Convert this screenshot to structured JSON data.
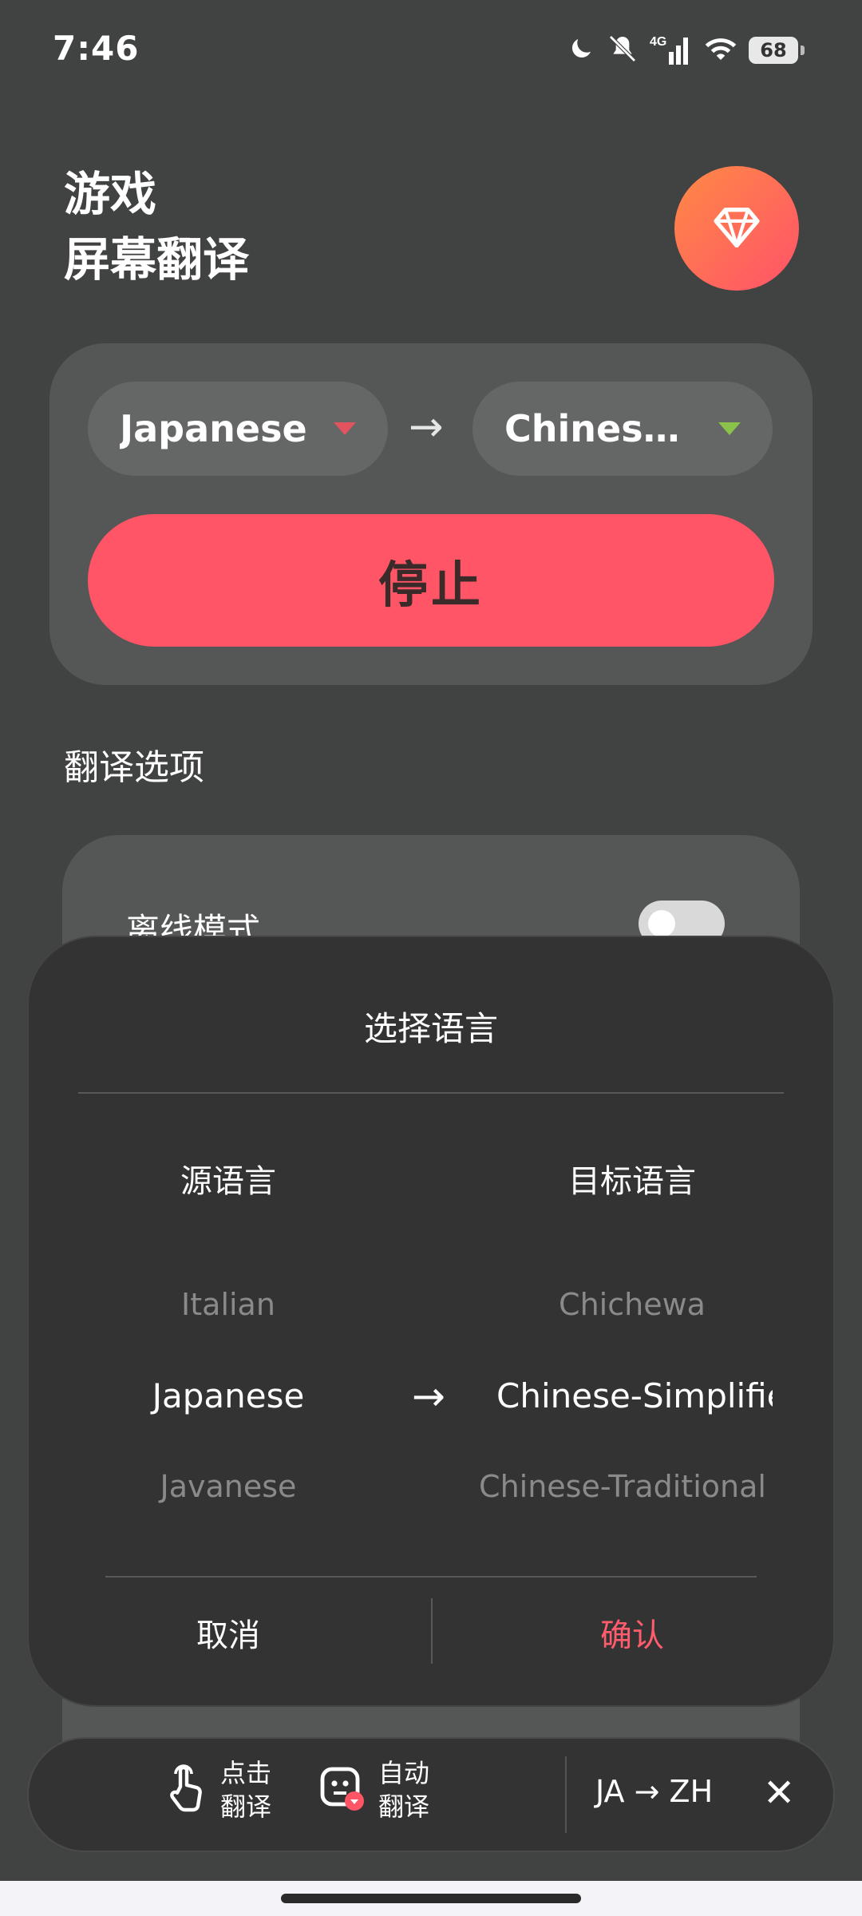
{
  "status": {
    "time": "7:46",
    "battery": "68",
    "network": "4G"
  },
  "header": {
    "line1": "游戏",
    "line2": "屏幕翻译"
  },
  "language_pair": {
    "source": "Japanese",
    "target": "Chinese...",
    "arrow": "→"
  },
  "stop_label": "停止",
  "options": {
    "title": "翻译选项",
    "offline_label": "离线模式"
  },
  "dialog": {
    "title": "选择语言",
    "source_header": "源语言",
    "target_header": "目标语言",
    "source_wheel": [
      "Italian",
      "Japanese",
      "Javanese"
    ],
    "target_wheel": [
      "Chichewa",
      "Chinese-Simplified",
      "Chinese-Traditional"
    ],
    "arrow": "→",
    "cancel": "取消",
    "confirm": "确认"
  },
  "float_bar": {
    "tap_line1": "点击",
    "tap_line2": "翻译",
    "auto_line1": "自动",
    "auto_line2": "翻译",
    "pair": "JA → ZH",
    "close": "✕"
  },
  "colors": {
    "accent": "#ff5566",
    "confirm": "#ff5c6e",
    "background": "#414242"
  }
}
